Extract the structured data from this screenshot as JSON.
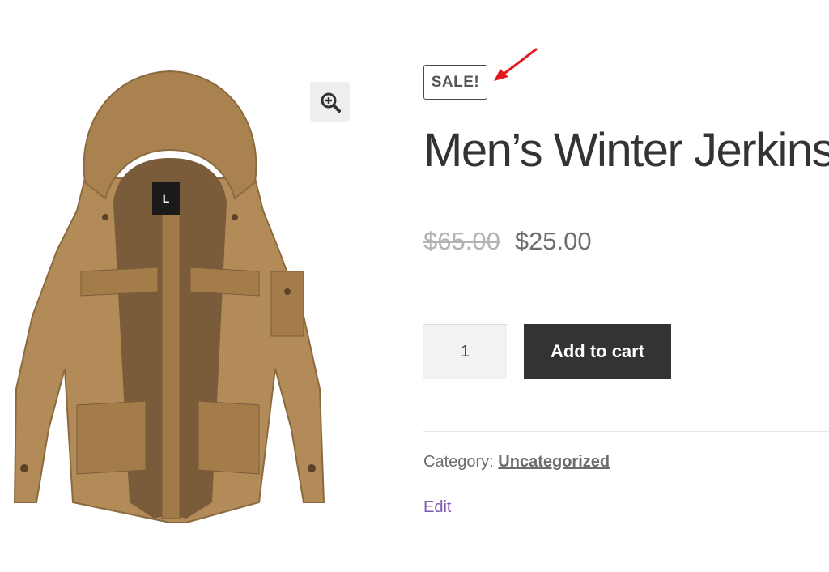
{
  "product": {
    "badge": "SALE!",
    "title": "Men’s Winter Jerkins",
    "price_old": "$65.00",
    "price_new": "$25.00",
    "image_label": "L",
    "image_icon": "hooded-winter-jacket"
  },
  "cart": {
    "quantity": "1",
    "add_label": "Add to cart"
  },
  "meta": {
    "category_label": "Category:",
    "category_value": "Uncategorized",
    "edit_label": "Edit"
  },
  "icons": {
    "zoom": "zoom-in-icon"
  },
  "colors": {
    "button_bg": "#333333",
    "link": "#7f54b3",
    "annotation_arrow": "#e0191f",
    "jacket": "#b38b58"
  }
}
